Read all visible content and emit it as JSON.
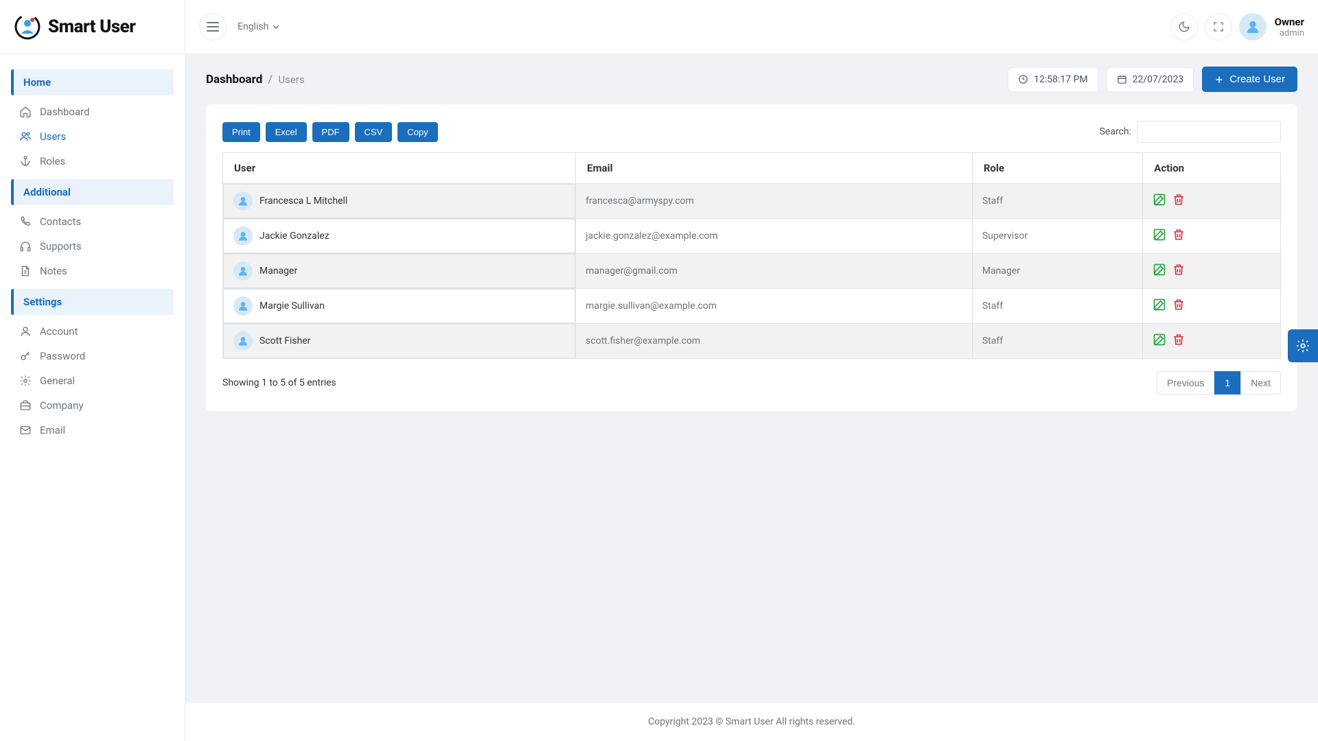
{
  "brand": {
    "name": "Smart User"
  },
  "topbar": {
    "language": "English",
    "user": {
      "name": "Owner",
      "role": "admin"
    }
  },
  "breadcrumb": {
    "root": "Dashboard",
    "leaf": "Users"
  },
  "header": {
    "time": "12:58:17 PM",
    "date": "22/07/2023",
    "create_label": "Create User"
  },
  "sidebar": {
    "sections": [
      {
        "title": "Home",
        "items": [
          {
            "label": "Dashboard",
            "icon": "home",
            "active": false
          },
          {
            "label": "Users",
            "icon": "users",
            "active": true
          },
          {
            "label": "Roles",
            "icon": "anchor",
            "active": false
          }
        ]
      },
      {
        "title": "Additional",
        "items": [
          {
            "label": "Contacts",
            "icon": "phone",
            "active": false
          },
          {
            "label": "Supports",
            "icon": "headphones",
            "active": false
          },
          {
            "label": "Notes",
            "icon": "file",
            "active": false
          }
        ]
      },
      {
        "title": "Settings",
        "items": [
          {
            "label": "Account",
            "icon": "user",
            "active": false
          },
          {
            "label": "Password",
            "icon": "key",
            "active": false
          },
          {
            "label": "General",
            "icon": "gear",
            "active": false
          },
          {
            "label": "Company",
            "icon": "briefcase",
            "active": false
          },
          {
            "label": "Email",
            "icon": "mail",
            "active": false
          }
        ]
      }
    ]
  },
  "toolbar": {
    "buttons": [
      "Print",
      "Excel",
      "PDF",
      "CSV",
      "Copy"
    ],
    "search_label": "Search:"
  },
  "table": {
    "columns": [
      "User",
      "Email",
      "Role",
      "Action"
    ],
    "rows": [
      {
        "name": "Francesca L Mitchell",
        "email": "francesca@armyspy.com",
        "role": "Staff"
      },
      {
        "name": "Jackie Gonzalez",
        "email": "jackie.gonzalez@example.com",
        "role": "Supervisor"
      },
      {
        "name": "Manager",
        "email": "manager@gmail.com",
        "role": "Manager"
      },
      {
        "name": "Margie Sullivan",
        "email": "margie.sullivan@example.com",
        "role": "Staff"
      },
      {
        "name": "Scott Fisher",
        "email": "scott.fisher@example.com",
        "role": "Staff"
      }
    ],
    "info": "Showing 1 to 5 of 5 entries"
  },
  "pagination": {
    "previous": "Previous",
    "next": "Next",
    "pages": [
      "1"
    ]
  },
  "footer": "Copyright 2023 © Smart User All rights reserved."
}
